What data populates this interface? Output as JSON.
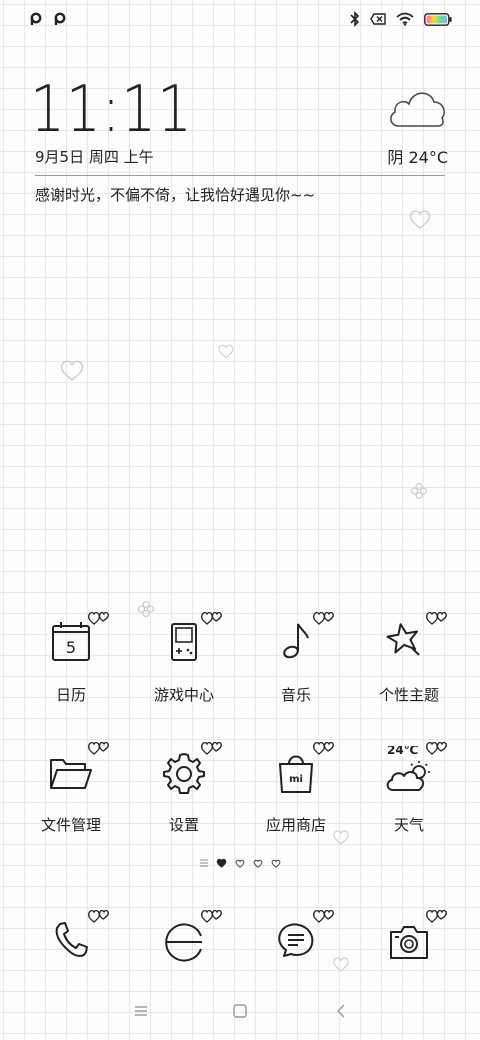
{
  "status_bar": {
    "left_icons": [
      "p-icon",
      "p-icon"
    ],
    "right_icons": [
      "bluetooth-icon",
      "no-sim-icon",
      "wifi-icon",
      "battery-icon"
    ]
  },
  "clock": {
    "time": "11:11",
    "date": "9月5日  周四  上午"
  },
  "weather": {
    "condition_temp": "阴  24°C"
  },
  "motto": "感谢时光，不偏不倚，让我恰好遇见你~~",
  "apps": [
    {
      "label": "日历",
      "icon": "calendar-icon",
      "calendar_day": "5"
    },
    {
      "label": "游戏中心",
      "icon": "gameboy-icon"
    },
    {
      "label": "音乐",
      "icon": "music-note-icon"
    },
    {
      "label": "个性主题",
      "icon": "star-wand-icon"
    },
    {
      "label": "文件管理",
      "icon": "folder-icon"
    },
    {
      "label": "设置",
      "icon": "gear-icon"
    },
    {
      "label": "应用商店",
      "icon": "shopping-bag-icon",
      "bag_text": "mi"
    },
    {
      "label": "天气",
      "icon": "weather-cloud-icon",
      "temp": "24℃"
    }
  ],
  "page_indicator": {
    "pages": 5,
    "current": 1
  },
  "dock": [
    {
      "icon": "phone-icon"
    },
    {
      "icon": "browser-icon"
    },
    {
      "icon": "message-icon"
    },
    {
      "icon": "camera-icon"
    }
  ],
  "navigation": [
    "menu-icon",
    "home-icon",
    "back-icon"
  ]
}
